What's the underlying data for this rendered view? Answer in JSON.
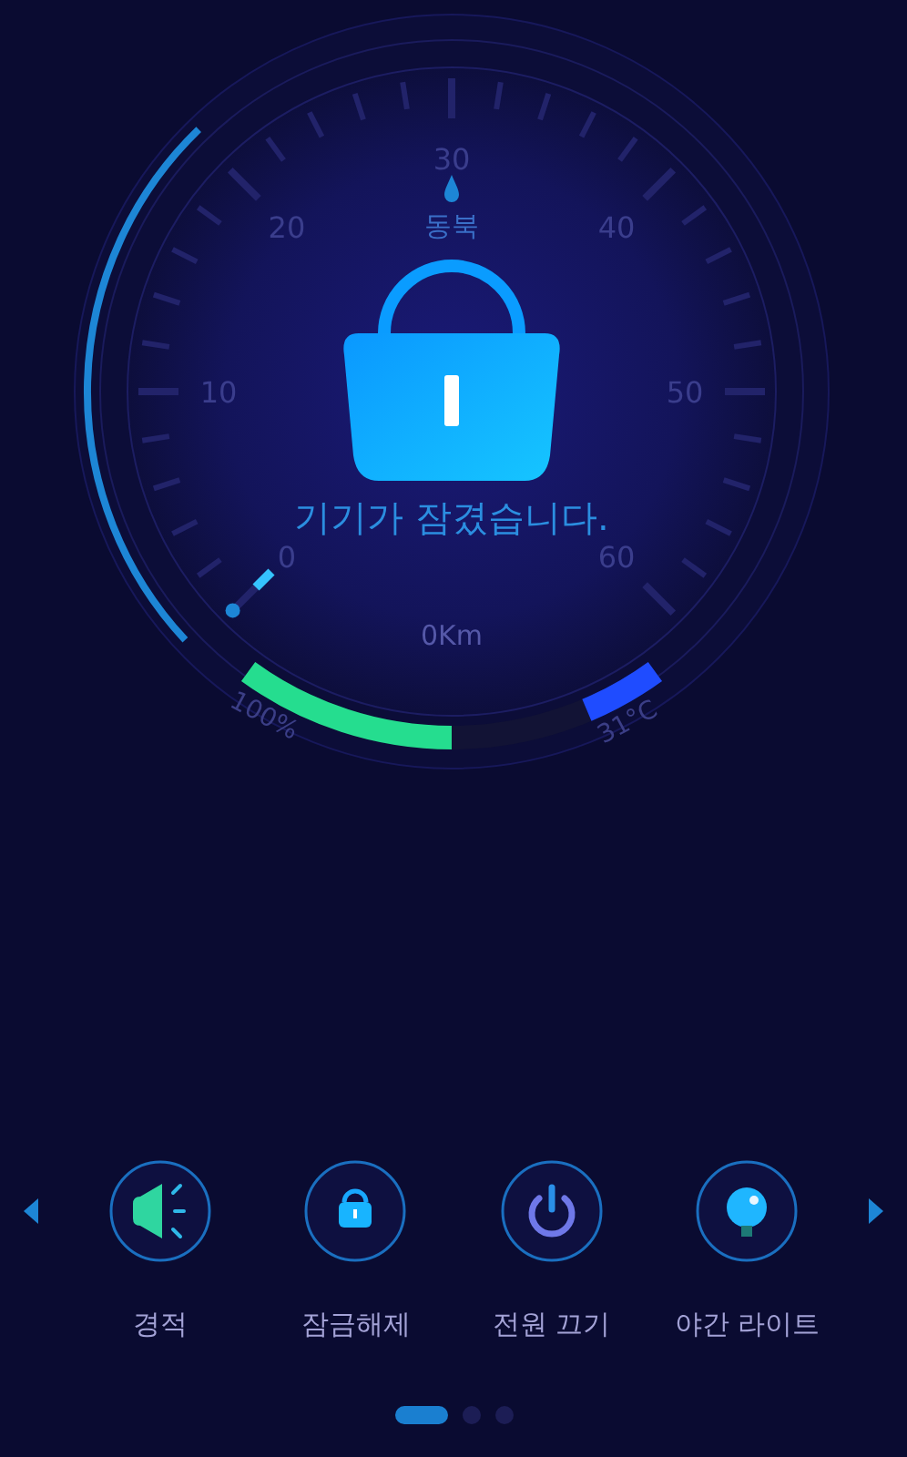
{
  "gauge": {
    "scale_labels": [
      "0",
      "10",
      "20",
      "30",
      "40",
      "50",
      "60"
    ],
    "direction": "동북",
    "status": "기기가 잠겼습니다.",
    "distance": "0Km",
    "battery": {
      "reading": "100%"
    },
    "temperature": {
      "reading": "31°C"
    }
  },
  "actions": [
    {
      "kind": "horn",
      "label": "경적"
    },
    {
      "kind": "lock",
      "label": "잠금해제"
    },
    {
      "kind": "power",
      "label": "전원 끄기"
    },
    {
      "kind": "bulb",
      "label": "야간 라이트"
    }
  ],
  "pager": [
    {
      "selected": true
    },
    {
      "selected": false
    },
    {
      "selected": false
    }
  ]
}
